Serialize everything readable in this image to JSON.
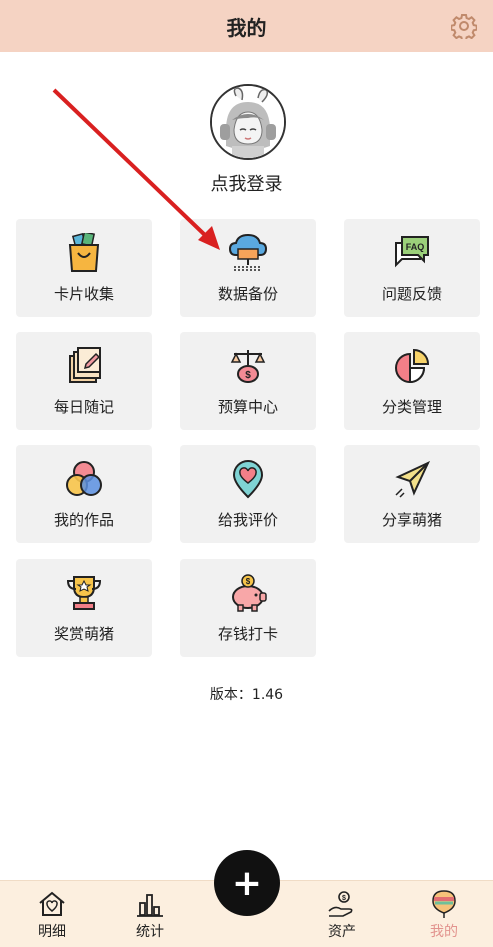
{
  "header": {
    "title": "我的"
  },
  "profile": {
    "login_text": "点我登录"
  },
  "cards": [
    {
      "label": "卡片收集",
      "icon": "shopping-bag-icon"
    },
    {
      "label": "数据备份",
      "icon": "cloud-server-icon"
    },
    {
      "label": "问题反馈",
      "icon": "faq-icon"
    },
    {
      "label": "每日随记",
      "icon": "notes-pen-icon"
    },
    {
      "label": "预算中心",
      "icon": "balance-scale-icon"
    },
    {
      "label": "分类管理",
      "icon": "pie-chart-icon"
    },
    {
      "label": "我的作品",
      "icon": "color-circles-icon"
    },
    {
      "label": "给我评价",
      "icon": "heart-pin-icon"
    },
    {
      "label": "分享萌猪",
      "icon": "paper-plane-icon"
    },
    {
      "label": "奖赏萌猪",
      "icon": "trophy-icon"
    },
    {
      "label": "存钱打卡",
      "icon": "piggy-bank-icon"
    }
  ],
  "version_text": "版本：1.46",
  "tabbar": {
    "tabs": [
      {
        "label": "明细",
        "icon": "home-heart-icon"
      },
      {
        "label": "统计",
        "icon": "bar-chart-icon"
      },
      {
        "label": "资产",
        "icon": "hand-coin-icon"
      },
      {
        "label": "我的",
        "icon": "balloon-icon"
      }
    ],
    "fab_label": "+",
    "active_color": "#e2938e"
  },
  "colors": {
    "header_bg": "#f5d3c3",
    "tabbar_bg": "#fcefdf",
    "card_bg": "#f1f1f1",
    "arrow": "#d92020"
  }
}
